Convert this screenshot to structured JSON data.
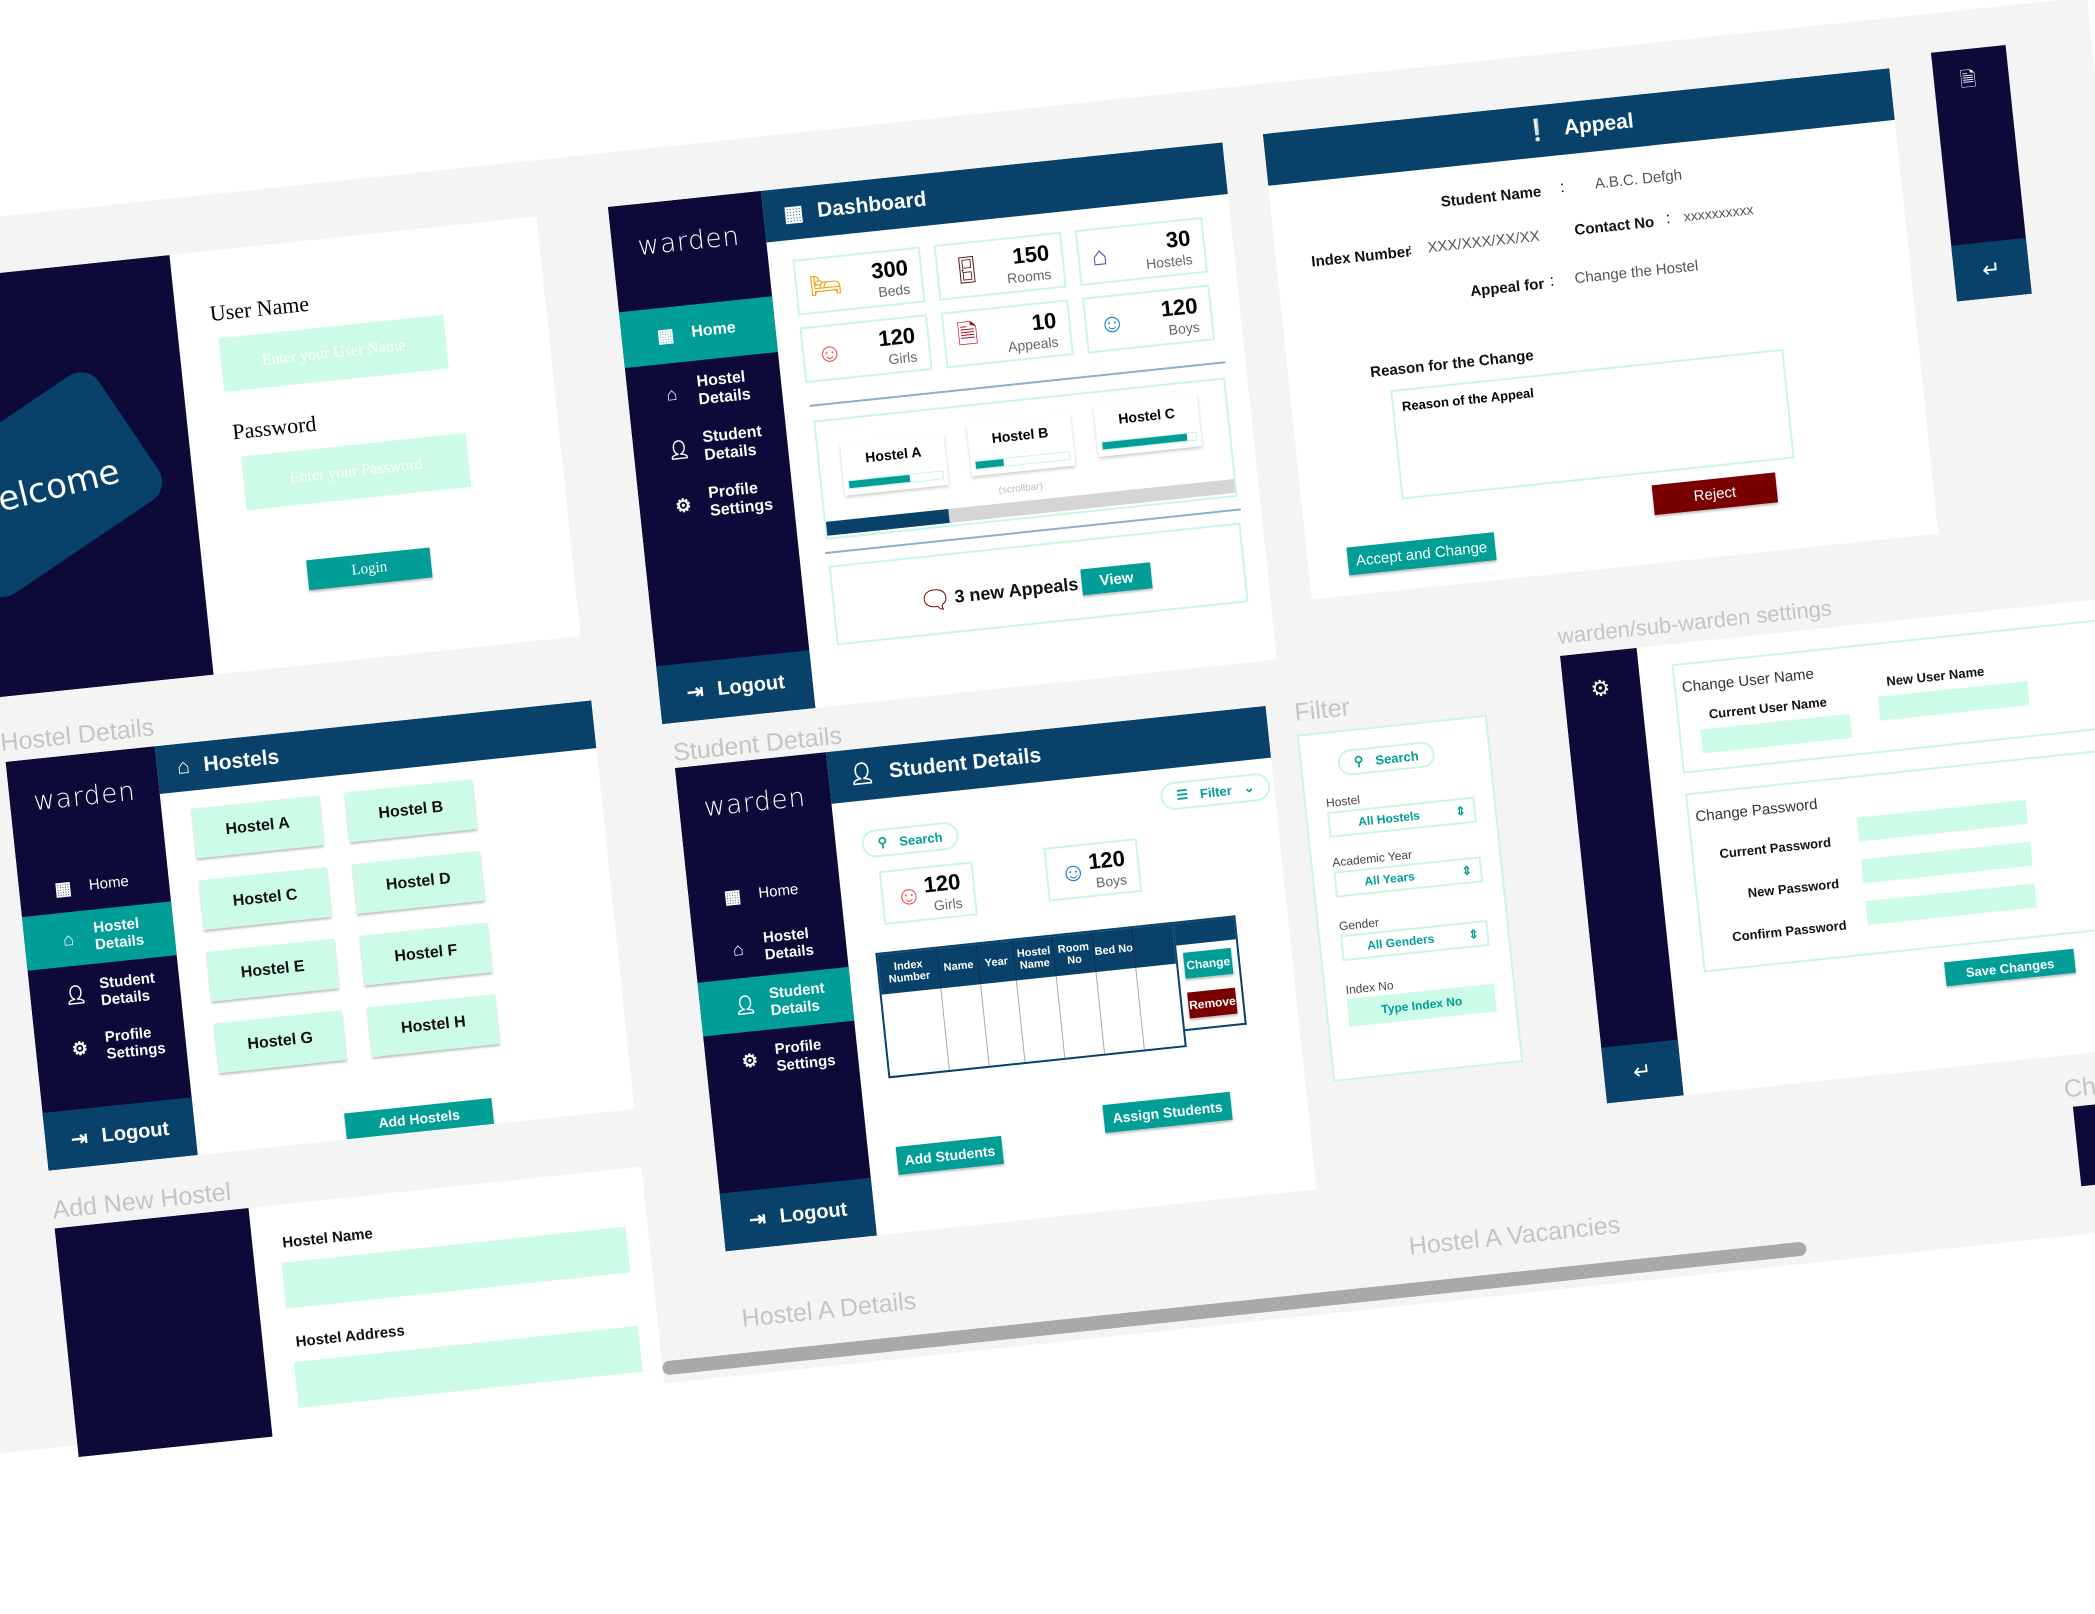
{
  "colors": {
    "navy": "#0d0a3a",
    "header_blue": "#08426b",
    "teal": "#009e96",
    "mint": "#ccfbe8",
    "danger": "#7a0000"
  },
  "brand": "warden",
  "nav": {
    "home": "Home",
    "hostel_details": "Hostel Details",
    "student_details": "Student Details",
    "profile_settings": "Profile Settings",
    "logout": "Logout"
  },
  "login": {
    "welcome": "welcome",
    "username_label": "User Name",
    "username_placeholder": "Enter your User Name",
    "password_label": "Password",
    "password_placeholder": "Enter your Password",
    "login_button": "Login"
  },
  "dashboard": {
    "title": "Dashboard",
    "stats": [
      {
        "value": "300",
        "label": "Beds",
        "icon": "bed-icon"
      },
      {
        "value": "150",
        "label": "Rooms",
        "icon": "door-icon"
      },
      {
        "value": "30",
        "label": "Hostels",
        "icon": "buildings-icon"
      },
      {
        "value": "120",
        "label": "Girls",
        "icon": "girl-icon"
      },
      {
        "value": "10",
        "label": "Appeals",
        "icon": "document-icon"
      },
      {
        "value": "120",
        "label": "Boys",
        "icon": "boy-icon"
      }
    ],
    "hostels": [
      {
        "name": "Hostel A",
        "occupancy": 65
      },
      {
        "name": "Hostel B",
        "occupancy": 30
      },
      {
        "name": "Hostel C",
        "occupancy": 90
      }
    ],
    "scrollbar_note": "(scrollbar)",
    "appeals_text": "3 new Appeals",
    "view_button": "View"
  },
  "appeal": {
    "title": "Appeal",
    "student_name_label": "Student Name",
    "student_name": "A.B.C. Defgh",
    "index_label": "Index Number",
    "index_value": "XXX/XXX/XX/XX",
    "contact_label": "Contact No",
    "contact_value": "xxxxxxxxxx",
    "appeal_for_label": "Appeal for",
    "appeal_for_value": "Change the Hostel",
    "reason_label": "Reason for the Change",
    "reason_value": "Reason of the Appeal",
    "colon": ":",
    "accept_button": "Accept and Change",
    "reject_button": "Reject"
  },
  "hostels_page": {
    "section_label": "Hostel Details",
    "title": "Hostels",
    "hostels": [
      "Hostel A",
      "Hostel B",
      "Hostel C",
      "Hostel D",
      "Hostel E",
      "Hostel F",
      "Hostel G",
      "Hostel H"
    ],
    "add_button": "Add Hostels"
  },
  "students_page": {
    "section_label": "Student Details",
    "title": "Student Details",
    "filter": "Filter",
    "search": "Search",
    "girls": {
      "value": "120",
      "label": "Girls"
    },
    "boys": {
      "value": "120",
      "label": "Boys"
    },
    "columns": [
      "Index Number",
      "Name",
      "Year",
      "Hostel Name",
      "Room No",
      "Bed No"
    ],
    "change_button": "Change",
    "remove_button": "Remove",
    "add_button": "Add Students",
    "assign_button": "Assign Students"
  },
  "filter": {
    "section_label": "Filter",
    "search": "Search",
    "hostel_label": "Hostel",
    "hostel_value": "All Hostels",
    "year_label": "Academic Year",
    "year_value": "All Years",
    "gender_label": "Gender",
    "gender_value": "All Genders",
    "index_label": "Index No",
    "index_placeholder": "Type Index No"
  },
  "settings": {
    "section_label": "warden/sub-warden settings",
    "change_username": "Change User Name",
    "current_username": "Current User Name",
    "new_username": "New User Name",
    "change_password": "Change Password",
    "current_password": "Current Password",
    "new_password": "New Password",
    "confirm_password": "Confirm Password",
    "save_button": "Save Changes"
  },
  "add_hostel": {
    "section_label": "Add New Hostel",
    "name_label": "Hostel Name",
    "address_label": "Hostel Address"
  },
  "other_labels": {
    "hostel_a_details": "Hostel A Details",
    "hostel_a_vacancies": "Hostel A Vacancies",
    "partial": "Cha"
  }
}
